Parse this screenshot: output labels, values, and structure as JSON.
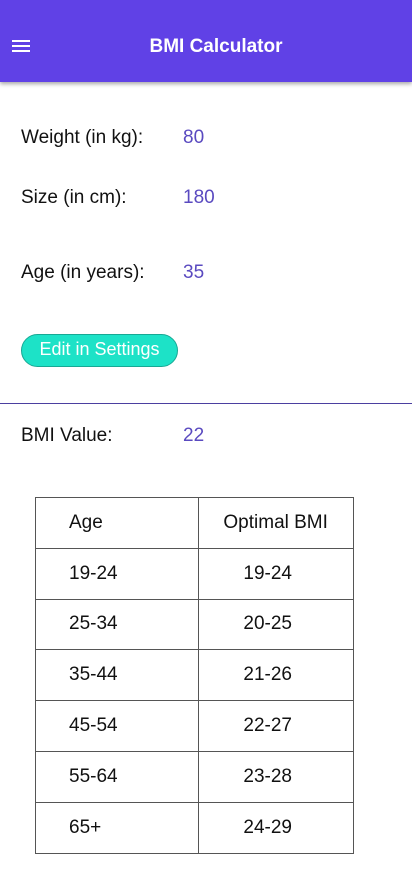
{
  "appbar": {
    "title": "BMI Calculator",
    "menu_icon": "hamburger-menu-icon",
    "color": "#6041e6"
  },
  "fields": {
    "weight": {
      "label": "Weight (in kg):",
      "value": "80"
    },
    "size": {
      "label": "Size (in cm):",
      "value": "180"
    },
    "age": {
      "label": "Age (in years):",
      "value": "35"
    }
  },
  "settings_button": {
    "label": "Edit in Settings",
    "color": "#1de2c7"
  },
  "bmi": {
    "label": "BMI Value:",
    "value": "22"
  },
  "table": {
    "headers": [
      "Age",
      "Optimal BMI"
    ],
    "rows": [
      [
        "19-24",
        "19-24"
      ],
      [
        "25-34",
        "20-25"
      ],
      [
        "35-44",
        "21-26"
      ],
      [
        "45-54",
        "22-27"
      ],
      [
        "55-64",
        "23-28"
      ],
      [
        "65+",
        "24-29"
      ]
    ]
  }
}
